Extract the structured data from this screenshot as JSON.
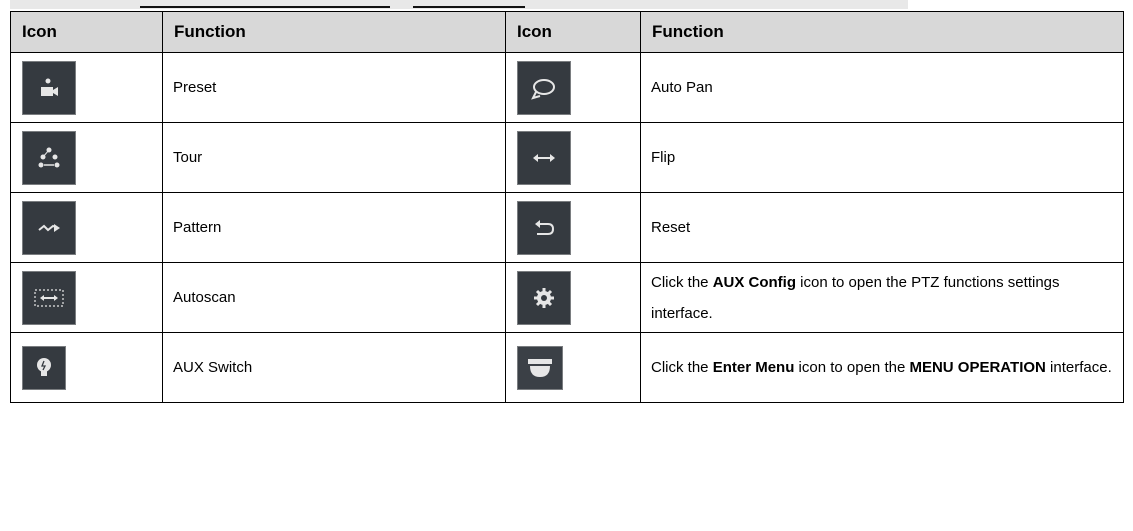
{
  "header": {
    "col1": "Icon",
    "col2": "Function",
    "col3": "Icon",
    "col4": "Function"
  },
  "rows": [
    {
      "left_icon": "preset-camera-icon",
      "left_text": "Preset",
      "right_icon": "auto-pan-icon",
      "right_text": "Auto Pan"
    },
    {
      "left_icon": "tour-icon",
      "left_text": "Tour",
      "right_icon": "flip-icon",
      "right_text": "Flip"
    },
    {
      "left_icon": "pattern-icon",
      "left_text": "Pattern",
      "right_icon": "reset-icon",
      "right_text": "Reset"
    },
    {
      "left_icon": "autoscan-icon",
      "left_text": "Autoscan",
      "right_icon": "aux-config-gear-icon",
      "right_rich": [
        "Click the ",
        "AUX Config",
        " icon to open the PTZ functions settings interface."
      ]
    },
    {
      "left_icon": "aux-switch-bulb-icon",
      "left_text": "AUX Switch",
      "right_icon": "enter-menu-dome-icon",
      "right_rich": [
        "Click the ",
        "Enter Menu",
        " icon to open the ",
        "MENU OPERATION",
        " interface."
      ]
    }
  ],
  "colors": {
    "header_bg": "#d8d8d8",
    "icon_bg": "#353a40",
    "icon_fg": "#e6e6e6"
  }
}
